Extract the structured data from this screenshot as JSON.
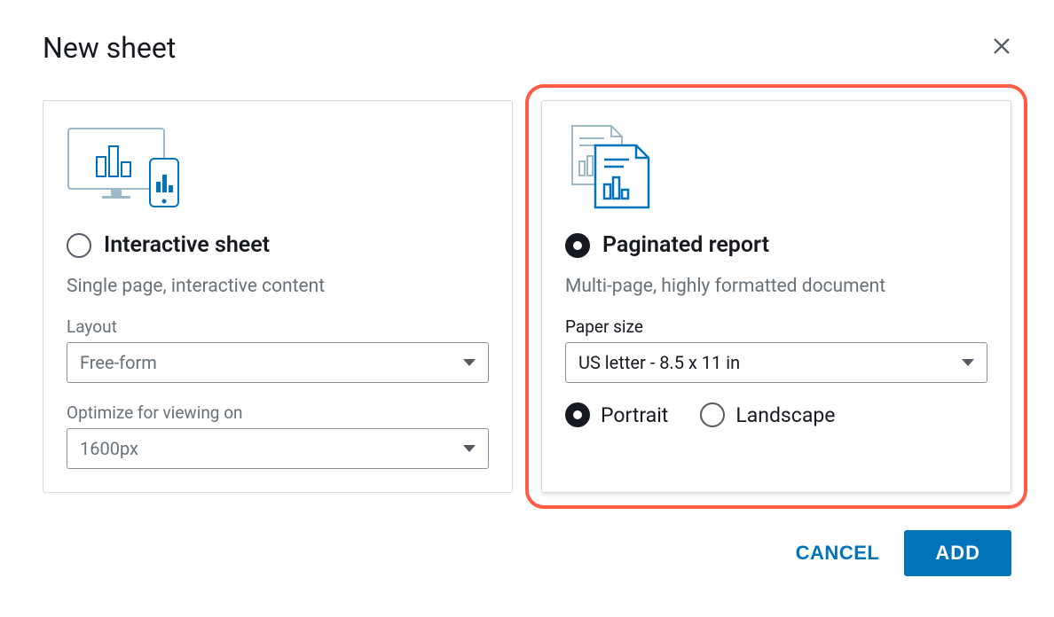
{
  "dialog": {
    "title": "New sheet"
  },
  "interactive_card": {
    "title": "Interactive sheet",
    "description": "Single page, interactive content",
    "layout_label": "Layout",
    "layout_value": "Free-form",
    "optimize_label": "Optimize for viewing on",
    "optimize_value": "1600px",
    "selected": false
  },
  "paginated_card": {
    "title": "Paginated report",
    "description": "Multi-page, highly formatted document",
    "paper_label": "Paper size",
    "paper_value": "US letter - 8.5 x 11 in",
    "orientation_portrait": "Portrait",
    "orientation_landscape": "Landscape",
    "selected": true,
    "orientation_selected": "portrait"
  },
  "actions": {
    "cancel": "CANCEL",
    "add": "ADD"
  }
}
